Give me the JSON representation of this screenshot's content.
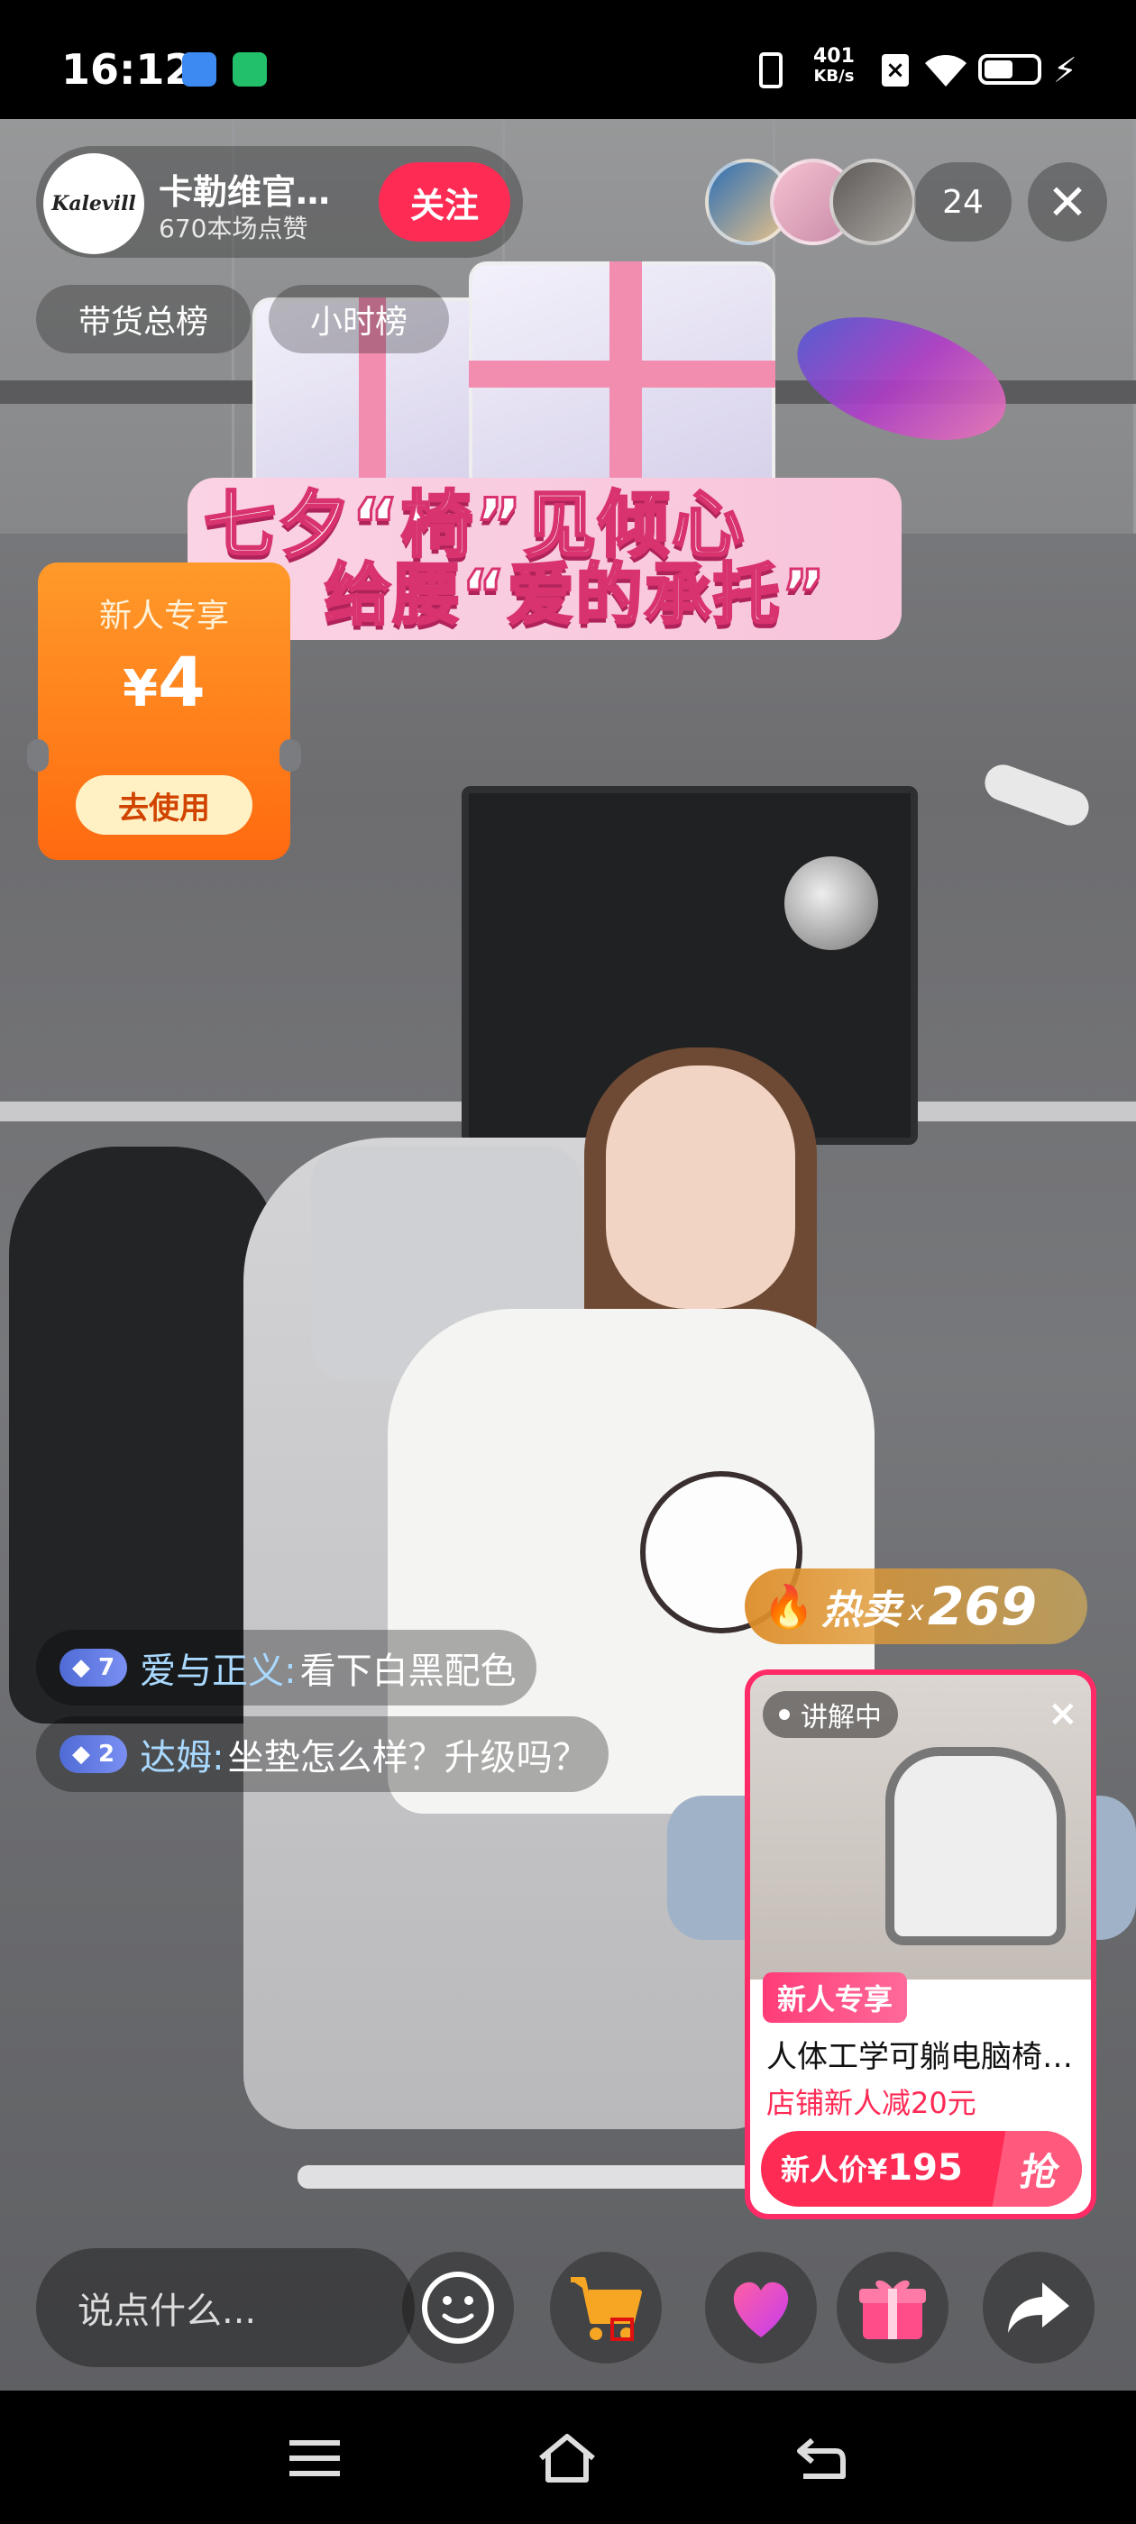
{
  "status_bar": {
    "time": "16:12",
    "net_speed_value": "401",
    "net_speed_unit": "KB/s",
    "battery_level_percent": 55
  },
  "header": {
    "avatar_logo_text": "Kalevill",
    "anchor_name": "卡勒维官…",
    "likes": "670本场点赞",
    "follow_label": "关注",
    "viewer_count": "24",
    "close_icon": "close-icon",
    "rank_tabs": [
      "带货总榜",
      "小时榜"
    ]
  },
  "banner": {
    "line1": "七夕“椅”见倾心",
    "line2": "给腰“爱的承托”"
  },
  "coupon": {
    "title": "新人专享",
    "currency": "¥",
    "amount": "4",
    "action_label": "去使用"
  },
  "comments": [
    {
      "level": "7",
      "name": "爱与正义:",
      "text": "看下白黑配色"
    },
    {
      "level": "2",
      "name": "达姆:",
      "text": "坐垫怎么样？升级吗？"
    }
  ],
  "hot_sale": {
    "label": "热卖",
    "multiplier": "x",
    "count": "269"
  },
  "product_card": {
    "status": "讲解中",
    "tag": "新人专享",
    "title": "人体工学可躺电脑椅…",
    "promo": "店铺新人减20元",
    "price_label": "新人价¥",
    "price": "195",
    "grab_label": "抢"
  },
  "bottom_bar": {
    "input_placeholder": "说点什么...",
    "icons": [
      "emoji-icon",
      "shopping-cart-icon",
      "heart-icon",
      "gift-icon",
      "share-icon"
    ]
  },
  "colors": {
    "follow": "#fe2c55",
    "coupon": "#ff7a18",
    "price": "#ff2a55"
  }
}
